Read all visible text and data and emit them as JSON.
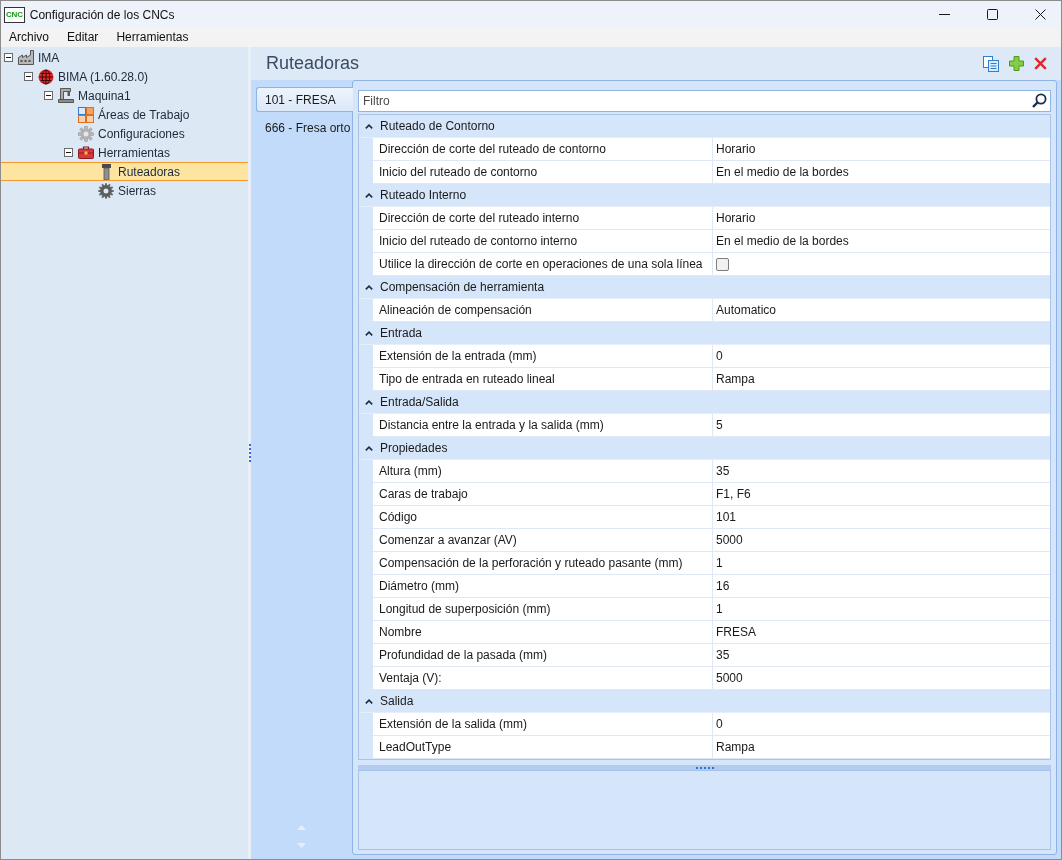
{
  "window": {
    "title": "Configuración de los CNCs",
    "logo_text": "CNC"
  },
  "menu": [
    "Archivo",
    "Editar",
    "Herramientas"
  ],
  "tree": [
    {
      "label": "IMA",
      "kind": "plant",
      "expanded": true,
      "selected": false,
      "children": [
        {
          "label": "BIMA (1.60.28.0)",
          "kind": "controller",
          "expanded": true,
          "selected": false,
          "children": [
            {
              "label": "Maquina1",
              "kind": "machine",
              "expanded": true,
              "selected": false,
              "children": [
                {
                  "label": "Áreas de Trabajo",
                  "kind": "areas",
                  "selected": false
                },
                {
                  "label": "Configuraciones",
                  "kind": "settings",
                  "selected": false
                },
                {
                  "label": "Herramientas",
                  "kind": "toolbox",
                  "expanded": true,
                  "selected": false,
                  "children": [
                    {
                      "label": "Ruteadoras",
                      "kind": "router",
                      "selected": true
                    },
                    {
                      "label": "Sierras",
                      "kind": "saw",
                      "selected": false
                    }
                  ]
                }
              ]
            }
          ]
        }
      ]
    }
  ],
  "panel": {
    "title": "Ruteadoras"
  },
  "tools": [
    {
      "label": "101 - FRESA",
      "selected": true
    },
    {
      "label": "666 - Fresa orto",
      "selected": false
    }
  ],
  "filter": {
    "placeholder": "Filtro"
  },
  "categories": [
    {
      "category": "Ruteado de Contorno",
      "expanded": true,
      "rows": [
        {
          "kind": "text",
          "name": "Dirección de corte del ruteado de contorno",
          "value": "Horario"
        },
        {
          "kind": "text",
          "name": "Inicio del ruteado de contorno",
          "value": "En el medio de la bordes"
        }
      ]
    },
    {
      "category": "Ruteado Interno",
      "expanded": true,
      "rows": [
        {
          "kind": "text",
          "name": "Dirección de corte del ruteado interno",
          "value": "Horario"
        },
        {
          "kind": "text",
          "name": "Inicio del ruteado de contorno interno",
          "value": "En el medio de la bordes"
        },
        {
          "kind": "checkbox",
          "name": "Utilice la dirección de corte en operaciones de una sola línea",
          "checked": false
        }
      ]
    },
    {
      "category": "Compensación de herramienta",
      "expanded": true,
      "rows": [
        {
          "kind": "text",
          "name": "Alineación de compensación",
          "value": "Automatico"
        }
      ]
    },
    {
      "category": "Entrada",
      "expanded": true,
      "rows": [
        {
          "kind": "text",
          "name": "Extensión de la entrada (mm)",
          "value": "0"
        },
        {
          "kind": "text",
          "name": "Tipo de entrada en ruteado lineal",
          "value": "Rampa"
        }
      ]
    },
    {
      "category": "Entrada/Salida",
      "expanded": true,
      "rows": [
        {
          "kind": "text",
          "name": "Distancia entre la entrada y la salida (mm)",
          "value": "5"
        }
      ]
    },
    {
      "category": "Propiedades",
      "expanded": true,
      "rows": [
        {
          "kind": "text",
          "name": "Altura (mm)",
          "value": "35"
        },
        {
          "kind": "text",
          "name": "Caras de trabajo",
          "value": "F1, F6"
        },
        {
          "kind": "text",
          "name": "Código",
          "value": "101"
        },
        {
          "kind": "text",
          "name": "Comenzar a avanzar (AV)",
          "value": "5000"
        },
        {
          "kind": "text",
          "name": "Compensación de la perforación y ruteado pasante (mm)",
          "value": "1"
        },
        {
          "kind": "text",
          "name": "Diámetro (mm)",
          "value": "16"
        },
        {
          "kind": "text",
          "name": "Longitud de superposición (mm)",
          "value": "1"
        },
        {
          "kind": "text",
          "name": "Nombre",
          "value": "FRESA"
        },
        {
          "kind": "text",
          "name": "Profundidad de la pasada (mm)",
          "value": "35"
        },
        {
          "kind": "text",
          "name": "Ventaja (V):",
          "value": "5000"
        }
      ]
    },
    {
      "category": "Salida",
      "expanded": true,
      "rows": [
        {
          "kind": "text",
          "name": "Extensión de la salida (mm)",
          "value": "0"
        },
        {
          "kind": "text",
          "name": "LeadOutType",
          "value": "Rampa"
        }
      ]
    }
  ]
}
